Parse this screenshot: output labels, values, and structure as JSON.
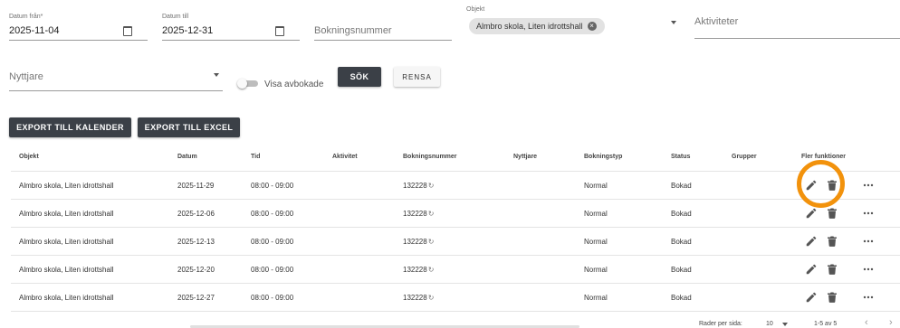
{
  "filters": {
    "date_from": {
      "label": "Datum från*",
      "value": "2025-11-04"
    },
    "date_to": {
      "label": "Datum till",
      "value": "2025-12-31"
    },
    "booking_number": {
      "placeholder": "Bokningsnummer"
    },
    "object": {
      "label": "Objekt",
      "chip": "Almbro skola, Liten idrottshall"
    },
    "activities": {
      "placeholder": "Aktiviteter"
    },
    "user": {
      "placeholder": "Nyttjare"
    },
    "show_cancelled": {
      "label": "Visa avbokade"
    },
    "search_label": "SÖK",
    "clear_label": "RENSA"
  },
  "actions": {
    "export_calendar": "EXPORT TILL KALENDER",
    "export_excel": "EXPORT TILL EXCEL"
  },
  "table": {
    "headers": [
      "Objekt",
      "Datum",
      "Tid",
      "Aktivitet",
      "Bokningsnummer",
      "Nyttjare",
      "Bokningstyp",
      "Status",
      "Grupper",
      "Fler funktioner"
    ],
    "rows": [
      {
        "object": "Almbro skola, Liten idrottshall",
        "date": "2025-11-29",
        "time": "08:00 - 09:00",
        "activity": "",
        "booking": "132228",
        "user": "",
        "type": "Normal",
        "status": "Bokad",
        "groups": ""
      },
      {
        "object": "Almbro skola, Liten idrottshall",
        "date": "2025-12-06",
        "time": "08:00 - 09:00",
        "activity": "",
        "booking": "132228",
        "user": "",
        "type": "Normal",
        "status": "Bokad",
        "groups": ""
      },
      {
        "object": "Almbro skola, Liten idrottshall",
        "date": "2025-12-13",
        "time": "08:00 - 09:00",
        "activity": "",
        "booking": "132228",
        "user": "",
        "type": "Normal",
        "status": "Bokad",
        "groups": ""
      },
      {
        "object": "Almbro skola, Liten idrottshall",
        "date": "2025-12-20",
        "time": "08:00 - 09:00",
        "activity": "",
        "booking": "132228",
        "user": "",
        "type": "Normal",
        "status": "Bokad",
        "groups": ""
      },
      {
        "object": "Almbro skola, Liten idrottshall",
        "date": "2025-12-27",
        "time": "08:00 - 09:00",
        "activity": "",
        "booking": "132228",
        "user": "",
        "type": "Normal",
        "status": "Bokad",
        "groups": ""
      }
    ]
  },
  "pagination": {
    "rows_per_page_label": "Rader per sida:",
    "rows_per_page": "10",
    "range": "1-5 av 5",
    "prev": "‹",
    "next": "›"
  },
  "icons": {
    "calendar": "calendar-icon",
    "refresh_glyph": "↻",
    "chip_close": "×",
    "edit": "pencil-icon",
    "delete": "trash-icon",
    "more": "more-horizontal-icon"
  },
  "colors": {
    "dark_button": "#3b4047",
    "highlight_ring": "#f2920c"
  }
}
